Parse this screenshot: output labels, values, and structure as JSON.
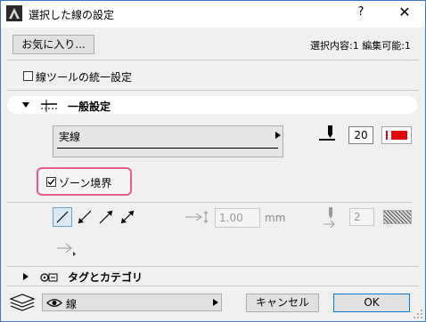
{
  "window": {
    "title": "選択した線の設定",
    "help_label": "?",
    "close_label": "✕"
  },
  "toolbar": {
    "favorites_label": "お気に入り...",
    "selection_info": "選択内容:1 編集可能:1"
  },
  "unify": {
    "label": "線ツールの統一設定",
    "checked": false
  },
  "general_section": {
    "title": "一般設定",
    "expanded": true
  },
  "line_type": {
    "selected": "実線"
  },
  "pen": {
    "value": "20",
    "color": "#e8000b"
  },
  "zone_boundary": {
    "label": "ゾーン境界",
    "checked": true
  },
  "arrow": {
    "size_value": "1.00",
    "unit": "mm",
    "pen_value": "2"
  },
  "tags_section": {
    "title": "タグとカテゴリ",
    "expanded": false
  },
  "footer": {
    "layer_label": "線",
    "cancel_label": "キャンセル",
    "ok_label": "OK"
  },
  "colors": {
    "accent": "#0078d7",
    "highlight": "#e85a8c",
    "pen_red": "#e8000b"
  }
}
